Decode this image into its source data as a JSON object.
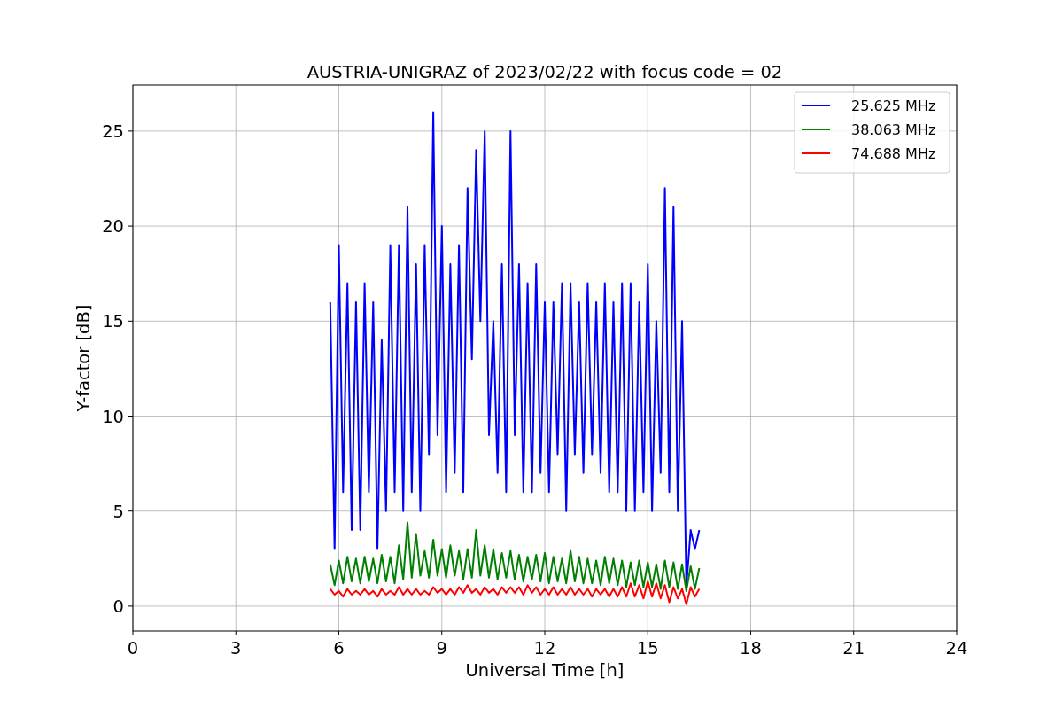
{
  "chart_data": {
    "type": "line",
    "title": "AUSTRIA-UNIGRAZ of 2023/02/22 with focus code = 02",
    "xlabel": "Universal Time [h]",
    "ylabel": "Y-factor [dB]",
    "xlim": [
      0,
      24
    ],
    "ylim": [
      -1.31,
      27.42
    ],
    "xticks": [
      0,
      3,
      6,
      9,
      12,
      15,
      18,
      21,
      24
    ],
    "yticks": [
      0,
      5,
      10,
      15,
      20,
      25
    ],
    "grid": true,
    "legend": true,
    "x": [
      5.75,
      5.875,
      6,
      6.125,
      6.25,
      6.375,
      6.5,
      6.625,
      6.75,
      6.875,
      7,
      7.125,
      7.25,
      7.375,
      7.5,
      7.625,
      7.75,
      7.875,
      8,
      8.125,
      8.25,
      8.375,
      8.5,
      8.625,
      8.75,
      8.875,
      9,
      9.125,
      9.25,
      9.375,
      9.5,
      9.625,
      9.75,
      9.875,
      10,
      10.125,
      10.25,
      10.375,
      10.5,
      10.625,
      10.75,
      10.875,
      11,
      11.125,
      11.25,
      11.375,
      11.5,
      11.625,
      11.75,
      11.875,
      12,
      12.125,
      12.25,
      12.375,
      12.5,
      12.625,
      12.75,
      12.875,
      13,
      13.125,
      13.25,
      13.375,
      13.5,
      13.625,
      13.75,
      13.875,
      14,
      14.125,
      14.25,
      14.375,
      14.5,
      14.625,
      14.75,
      14.875,
      15,
      15.125,
      15.25,
      15.375,
      15.5,
      15.625,
      15.75,
      15.875,
      16,
      16.125,
      16.25,
      16.375,
      16.5
    ],
    "series": [
      {
        "name": "25.625 MHz",
        "color": "#0000ff",
        "values": [
          16,
          3,
          19,
          6,
          17,
          4,
          16,
          4,
          17,
          6,
          16,
          3,
          14,
          5,
          19,
          6,
          19,
          5,
          21,
          6,
          18,
          5,
          19,
          8,
          26,
          9,
          20,
          6,
          18,
          7,
          19,
          6,
          22,
          13,
          24,
          15,
          25,
          9,
          15,
          7,
          18,
          6,
          25,
          9,
          18,
          6,
          17,
          6,
          18,
          7,
          16,
          6,
          16,
          8,
          17,
          5,
          17,
          8,
          16,
          7,
          17,
          8,
          16,
          7,
          17,
          6,
          16,
          6,
          17,
          5,
          17,
          5,
          16,
          6,
          18,
          5,
          15,
          7,
          22,
          6,
          21,
          5,
          15,
          1,
          4,
          3,
          4
        ]
      },
      {
        "name": "38.063 MHz",
        "color": "#008000",
        "values": [
          2.2,
          1.1,
          2.4,
          1.2,
          2.6,
          1.3,
          2.5,
          1.2,
          2.6,
          1.3,
          2.5,
          1.2,
          2.7,
          1.3,
          2.6,
          1.2,
          3.2,
          1.4,
          4.4,
          1.5,
          3.8,
          1.6,
          2.9,
          1.5,
          3.5,
          1.6,
          3.0,
          1.5,
          3.2,
          1.6,
          2.9,
          1.4,
          3.0,
          1.5,
          4.0,
          1.6,
          3.2,
          1.5,
          3.0,
          1.4,
          2.8,
          1.5,
          2.9,
          1.4,
          2.7,
          1.3,
          2.6,
          1.4,
          2.7,
          1.3,
          2.8,
          1.2,
          2.6,
          1.3,
          2.5,
          1.2,
          2.9,
          1.3,
          2.6,
          1.2,
          2.5,
          1.2,
          2.4,
          1.1,
          2.6,
          1.2,
          2.5,
          1.1,
          2.4,
          1.0,
          2.3,
          1.1,
          2.4,
          1.0,
          2.3,
          1.0,
          2.2,
          0.9,
          2.4,
          1.0,
          2.3,
          0.9,
          2.2,
          0.8,
          2.1,
          0.9,
          2.0
        ]
      },
      {
        "name": "74.688 MHz",
        "color": "#ff0000",
        "values": [
          0.9,
          0.6,
          0.8,
          0.5,
          0.9,
          0.6,
          0.8,
          0.6,
          0.9,
          0.6,
          0.8,
          0.5,
          0.9,
          0.6,
          0.8,
          0.6,
          1.0,
          0.6,
          0.9,
          0.6,
          0.9,
          0.6,
          0.8,
          0.6,
          1.0,
          0.7,
          0.9,
          0.6,
          0.9,
          0.6,
          1.0,
          0.7,
          1.1,
          0.7,
          0.9,
          0.6,
          1.0,
          0.7,
          0.9,
          0.6,
          1.0,
          0.7,
          1.0,
          0.7,
          1.0,
          0.6,
          1.1,
          0.7,
          1.0,
          0.6,
          0.9,
          0.6,
          1.0,
          0.6,
          0.9,
          0.6,
          1.0,
          0.6,
          0.9,
          0.6,
          0.9,
          0.5,
          0.9,
          0.6,
          0.9,
          0.5,
          0.9,
          0.5,
          1.0,
          0.5,
          1.2,
          0.5,
          1.1,
          0.4,
          1.3,
          0.5,
          1.2,
          0.4,
          1.1,
          0.2,
          1.0,
          0.4,
          0.9,
          0.1,
          1.0,
          0.5,
          0.9
        ]
      }
    ]
  }
}
